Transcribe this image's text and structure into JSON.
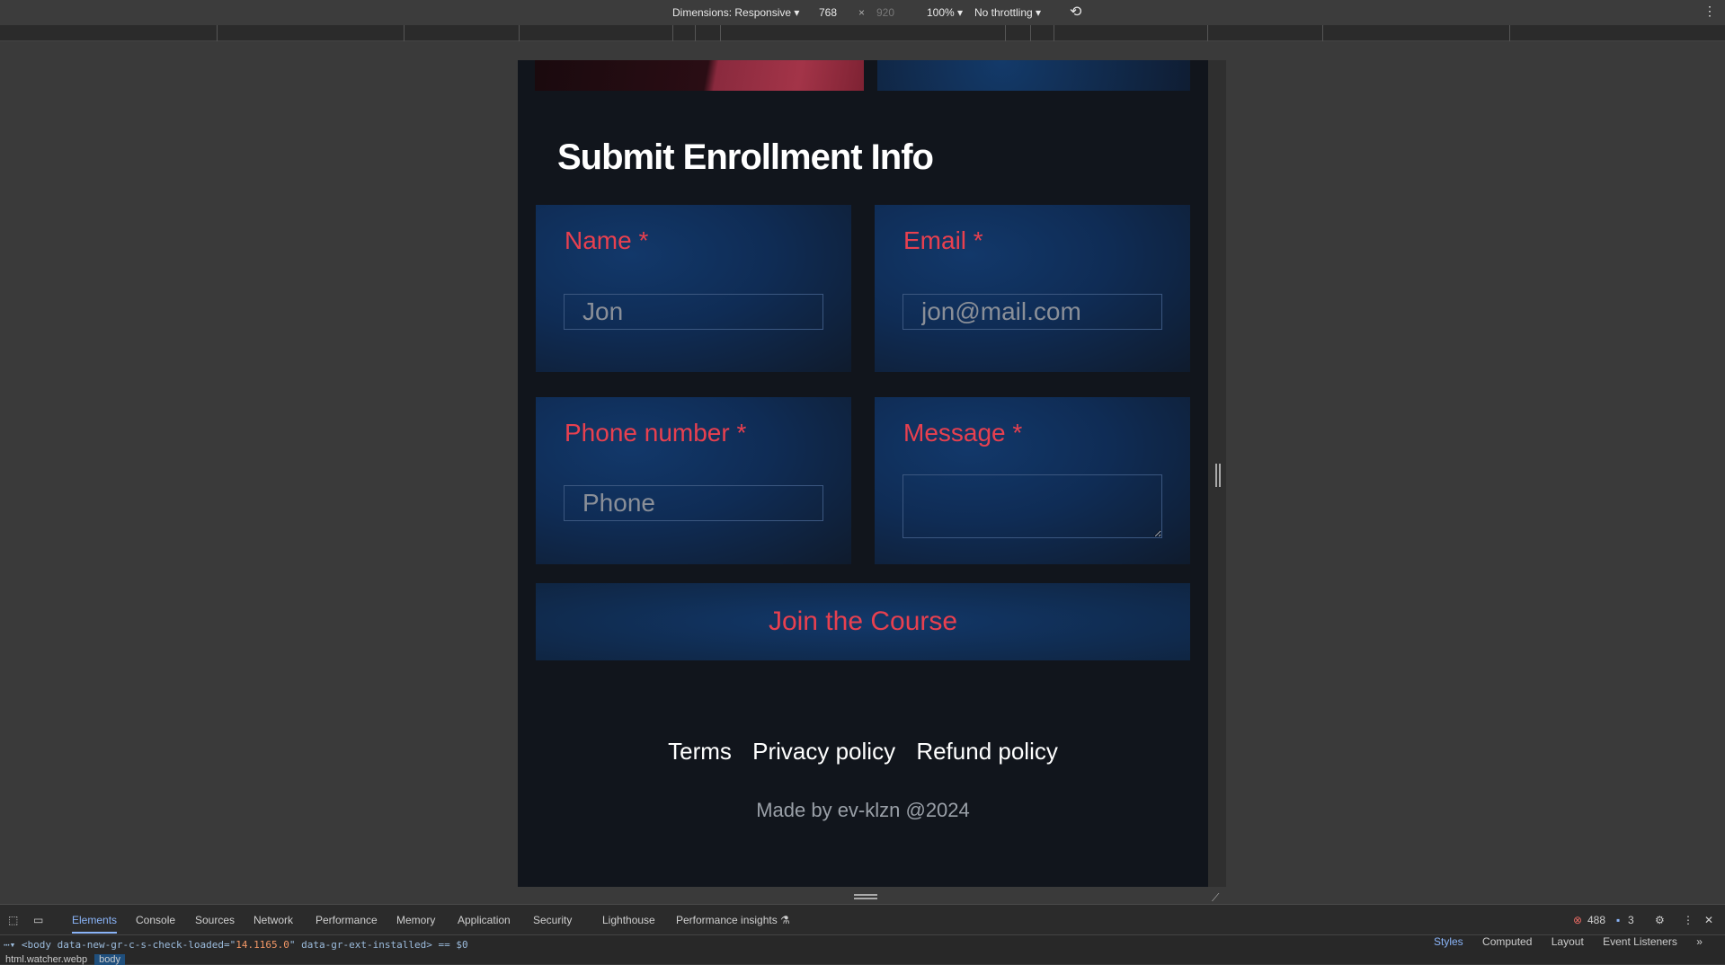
{
  "devtools_toolbar": {
    "dimensions": "Dimensions: Responsive ▾",
    "width": "768",
    "times": "×",
    "height": "920",
    "zoom": "100% ▾",
    "throttling": "No throttling ▾",
    "rotate_icon": "rotate-icon"
  },
  "page": {
    "title": "Submit Enrollment Info",
    "fields": [
      {
        "label": "Name *",
        "placeholder": "Jon"
      },
      {
        "label": "Email *",
        "placeholder": "jon@mail.com"
      },
      {
        "label": "Phone number *",
        "placeholder": "Phone"
      },
      {
        "label": "Message *",
        "placeholder": ""
      }
    ],
    "submit": "Join the Course",
    "footer_links": [
      "Terms",
      "Privacy policy",
      "Refund policy"
    ],
    "made_by": "Made by ev-klzn @2024",
    "colors": {
      "accent": "#e8404f",
      "background": "#11151c",
      "card": "#12386a"
    }
  },
  "devtools": {
    "tabs": [
      "Elements",
      "Console",
      "Sources",
      "Network",
      "Performance",
      "Memory",
      "Application",
      "Security",
      "Lighthouse",
      "Performance insights"
    ],
    "errors": "488",
    "messages": "3",
    "code_prefix": "<body data-new-gr-c-s-check-loaded=\"",
    "code_value": "14.1165.0",
    "code_suffix": "\" data-gr-ext-installed> == $0",
    "breadcrumbs": [
      "html.watcher.webp",
      "body"
    ],
    "side_tabs": [
      "Styles",
      "Computed",
      "Layout",
      "Event Listeners",
      "»"
    ]
  }
}
